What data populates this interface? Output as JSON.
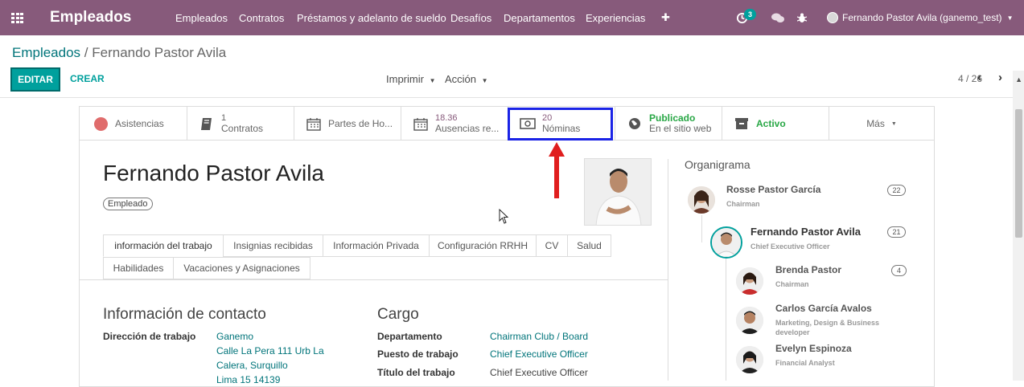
{
  "topbar": {
    "app_title": "Empleados",
    "menu": [
      "Empleados",
      "Contratos",
      "Préstamos y adelanto de sueldo",
      "Desafíos",
      "Departamentos",
      "Experiencias"
    ],
    "plus": "✚",
    "activity_count": "3",
    "user_label": "Fernando Pastor Avila (ganemo_test)"
  },
  "breadcrumb": {
    "parent": "Empleados",
    "separator": "/",
    "current": "Fernando Pastor Avila"
  },
  "toolbar": {
    "edit_label": "EDITAR",
    "create_label": "CREAR",
    "print_label": "Imprimir",
    "action_label": "Acción",
    "pager": "4 / 26"
  },
  "smart_buttons": {
    "attendance": "Asistencias",
    "contracts_count": "1",
    "contracts_label": "Contratos",
    "timesheets": "Partes de Ho...",
    "absences_count": "18.36",
    "absences_label": "Ausencias re...",
    "payslips_count": "20",
    "payslips_label": "Nóminas",
    "published": "Publicado",
    "website": "En el sitio web",
    "active": "Activo",
    "more": "Más"
  },
  "employee": {
    "name": "Fernando Pastor Avila",
    "tag": "Empleado"
  },
  "tabs": [
    "información del trabajo",
    "Insignias recibidas",
    "Información Privada",
    "Configuración RRHH",
    "CV",
    "Salud",
    "Habilidades",
    "Vacaciones y Asignaciones"
  ],
  "contact": {
    "title": "Información de contacto",
    "work_address_label": "Dirección de trabajo",
    "work_address_lines": [
      "Ganemo",
      "Calle La Pera 111 Urb La",
      "Calera, Surquillo",
      "Lima 15 14139"
    ]
  },
  "position": {
    "title": "Cargo",
    "department_label": "Departamento",
    "department_value": "Chairman Club / Board",
    "job_label": "Puesto de trabajo",
    "job_value": "Chief Executive Officer",
    "job_title_label": "Título del trabajo",
    "job_title_value": "Chief Executive Officer"
  },
  "org_chart": {
    "title": "Organigrama",
    "manager": {
      "name": "Rosse Pastor García",
      "job": "Chairman",
      "count": "22"
    },
    "self": {
      "name": "Fernando Pastor Avila",
      "job": "Chief Executive Officer",
      "count": "21"
    },
    "subordinates": [
      {
        "name": "Brenda Pastor",
        "job": "Chairman",
        "count": "4"
      },
      {
        "name": "Carlos García Avalos",
        "job_lines": [
          "Marketing, Design & Business",
          "developer"
        ]
      },
      {
        "name": "Evelyn Espinoza",
        "job": "Financial Analyst"
      }
    ]
  },
  "colors": {
    "brand": "#875a7b",
    "accent": "#00a09d",
    "link": "#00747a",
    "highlight_box": "#1a23e6",
    "arrow": "#e01e1e",
    "published": "#28a745"
  }
}
